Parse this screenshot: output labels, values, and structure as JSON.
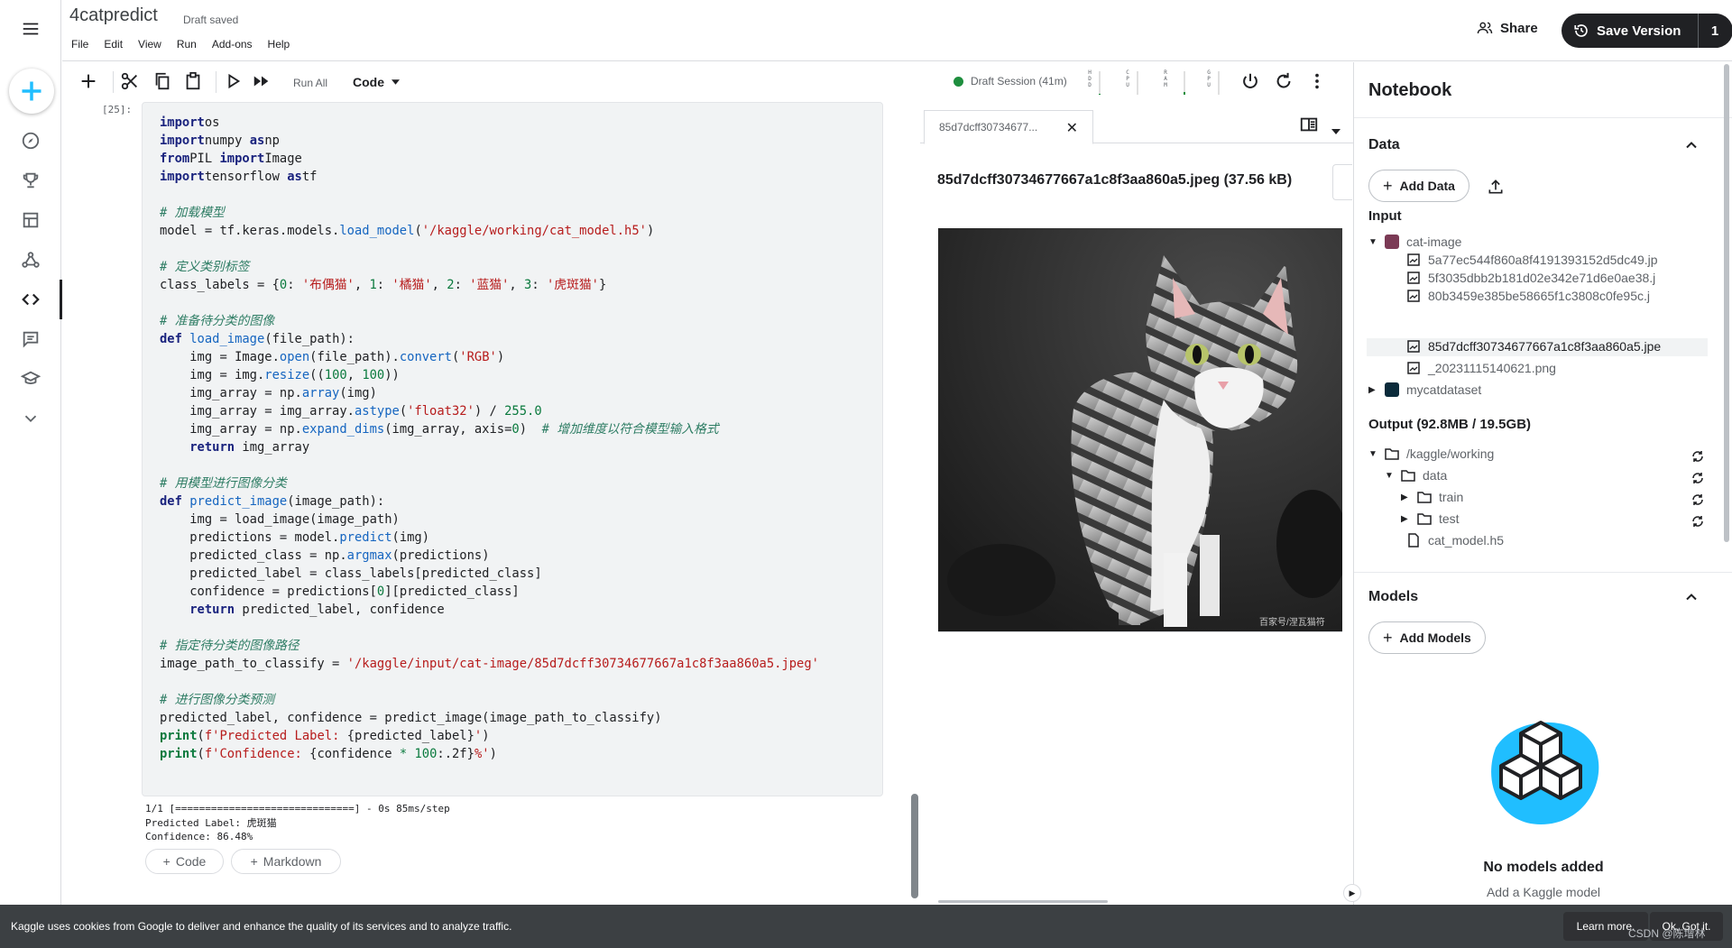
{
  "header": {
    "title": "4catpredict",
    "status": "Draft saved",
    "menu": [
      "File",
      "Edit",
      "View",
      "Run",
      "Add-ons",
      "Help"
    ],
    "share_label": "Share",
    "save_label": "Save Version",
    "save_count": "1"
  },
  "toolbar": {
    "run_all_label": "Run All",
    "cell_type": "Code",
    "session_label": "Draft Session (41m)",
    "meters": [
      {
        "label": "H\nD\nD",
        "level": 0.05
      },
      {
        "label": "C\nP\nU",
        "level": 0.0
      },
      {
        "label": "R\nA\nM",
        "level": 0.1
      },
      {
        "label": "G\nP\nU",
        "level": 0.0
      }
    ]
  },
  "cell": {
    "exec_count": "[25]:",
    "code_lines": [
      [
        [
          "kw",
          "import"
        ],
        [
          "",
          "os"
        ]
      ],
      [
        [
          "kw",
          "import"
        ],
        [
          "",
          "numpy "
        ],
        [
          "kw",
          "as"
        ],
        [
          "",
          "np"
        ]
      ],
      [
        [
          "kw",
          "from"
        ],
        [
          "",
          "PIL "
        ],
        [
          "kw",
          "import"
        ],
        [
          "",
          "Image"
        ]
      ],
      [
        [
          "kw",
          "import"
        ],
        [
          "",
          "tensorflow "
        ],
        [
          "kw",
          "as"
        ],
        [
          "",
          "tf"
        ]
      ],
      [],
      [
        [
          "cm",
          "# 加载模型"
        ]
      ],
      [
        [
          "",
          "model = tf.keras.models."
        ],
        [
          "fn",
          "load_model"
        ],
        [
          "",
          "("
        ],
        [
          "st",
          "'/kaggle/working/cat_model.h5'"
        ],
        [
          "",
          ")"
        ]
      ],
      [],
      [
        [
          "cm",
          "# 定义类别标签"
        ]
      ],
      [
        [
          "",
          "class_labels = {"
        ],
        [
          "nm",
          "0"
        ],
        [
          "",
          ": "
        ],
        [
          "st",
          "'布偶猫'"
        ],
        [
          "",
          ", "
        ],
        [
          "nm",
          "1"
        ],
        [
          "",
          ": "
        ],
        [
          "st",
          "'橘猫'"
        ],
        [
          "",
          ", "
        ],
        [
          "nm",
          "2"
        ],
        [
          "",
          ": "
        ],
        [
          "st",
          "'蓝猫'"
        ],
        [
          "",
          ", "
        ],
        [
          "nm",
          "3"
        ],
        [
          "",
          ": "
        ],
        [
          "st",
          "'虎斑猫'"
        ],
        [
          "",
          "}"
        ]
      ],
      [],
      [
        [
          "cm",
          "# 准备待分类的图像"
        ]
      ],
      [
        [
          "kw",
          "def"
        ],
        [
          "",
          " "
        ],
        [
          "fn",
          "load_image"
        ],
        [
          "",
          "(file_path):"
        ]
      ],
      [
        [
          "",
          "    img = Image."
        ],
        [
          "fn",
          "open"
        ],
        [
          "",
          "(file_path)."
        ],
        [
          "fn",
          "convert"
        ],
        [
          "",
          "("
        ],
        [
          "st",
          "'RGB'"
        ],
        [
          "",
          ")"
        ]
      ],
      [
        [
          "",
          "    img = img."
        ],
        [
          "fn",
          "resize"
        ],
        [
          "",
          "(("
        ],
        [
          "nm",
          "100"
        ],
        [
          "",
          ", "
        ],
        [
          "nm",
          "100"
        ],
        [
          "",
          "))"
        ]
      ],
      [
        [
          "",
          "    img_array = np."
        ],
        [
          "fn",
          "array"
        ],
        [
          "",
          "(img)"
        ]
      ],
      [
        [
          "",
          "    img_array = img_array."
        ],
        [
          "fn",
          "astype"
        ],
        [
          "",
          "("
        ],
        [
          "st",
          "'float32'"
        ],
        [
          "",
          ") / "
        ],
        [
          "nm",
          "255.0"
        ]
      ],
      [
        [
          "",
          "    img_array = np."
        ],
        [
          "fn",
          "expand_dims"
        ],
        [
          "",
          "(img_array, axis="
        ],
        [
          "nm",
          "0"
        ],
        [
          "",
          ")  "
        ],
        [
          "cm",
          "# 增加维度以符合模型输入格式"
        ]
      ],
      [
        [
          "",
          "    "
        ],
        [
          "kw",
          "return"
        ],
        [
          "",
          " img_array"
        ]
      ],
      [],
      [
        [
          "cm",
          "# 用模型进行图像分类"
        ]
      ],
      [
        [
          "kw",
          "def"
        ],
        [
          "",
          " "
        ],
        [
          "fn",
          "predict_image"
        ],
        [
          "",
          "(image_path):"
        ]
      ],
      [
        [
          "",
          "    img = load_image(image_path)"
        ]
      ],
      [
        [
          "",
          "    predictions = model."
        ],
        [
          "fn",
          "predict"
        ],
        [
          "",
          "(img)"
        ]
      ],
      [
        [
          "",
          "    predicted_class = np."
        ],
        [
          "fn",
          "argmax"
        ],
        [
          "",
          "(predictions)"
        ]
      ],
      [
        [
          "",
          "    predicted_label = class_labels[predicted_class]"
        ]
      ],
      [
        [
          "",
          "    confidence = predictions["
        ],
        [
          "nm",
          "0"
        ],
        [
          "",
          "][predicted_class]"
        ]
      ],
      [
        [
          "",
          "    "
        ],
        [
          "kw",
          "return"
        ],
        [
          "",
          " predicted_label, confidence"
        ]
      ],
      [],
      [
        [
          "cm",
          "# 指定待分类的图像路径"
        ]
      ],
      [
        [
          "",
          "image_path_to_classify = "
        ],
        [
          "st",
          "'/kaggle/input/cat-image/85d7dcff30734677667a1c8f3aa860a5.jpeg'"
        ]
      ],
      [],
      [
        [
          "cm",
          "# 进行图像分类预测"
        ]
      ],
      [
        [
          "",
          "predicted_label, confidence = predict_image(image_path_to_classify)"
        ]
      ],
      [
        [
          "kw2",
          "print"
        ],
        [
          "",
          "("
        ],
        [
          "st",
          "f'Predicted Label: "
        ],
        [
          "",
          "{predicted_label}"
        ],
        [
          "st",
          "'"
        ],
        [
          "",
          ")"
        ]
      ],
      [
        [
          "kw2",
          "print"
        ],
        [
          "",
          "("
        ],
        [
          "st",
          "f'Confidence: "
        ],
        [
          "",
          "{confidence "
        ],
        [
          "nm",
          "* 100"
        ],
        [
          "",
          ":.2f}"
        ],
        [
          "st",
          "%'"
        ],
        [
          "",
          ")"
        ]
      ]
    ],
    "output_lines": [
      "1/1 [==============================] - 0s 85ms/step",
      "Predicted Label: 虎斑猫",
      "Confidence: 86.48%"
    ],
    "add_code_label": "Code",
    "add_markdown_label": "Markdown"
  },
  "viewer": {
    "tab_label": "85d7dcff30734677...",
    "file_title": "85d7dcff30734677667a1c8f3aa860a5.jpeg (37.56 kB)",
    "image_watermark": "百家号/涅瓦猫符"
  },
  "panel": {
    "title": "Notebook",
    "data_section": "Data",
    "add_data_label": "Add Data",
    "input_label": "Input",
    "input_tree": {
      "dataset": "cat-image",
      "files": [
        "5a77ec544f860a8f4191393152d5dc49.jp",
        "5f3035dbb2b181d02e342e71d6e0ae38.j",
        "80b3459e385be58665f1c3808c0fe95c.j",
        "85d7dcff30734677667a1c8f3aa860a5.jpe",
        "_20231115140621.png"
      ],
      "dataset2": "mycatdataset"
    },
    "output_label": "Output (92.8MB / 19.5GB)",
    "output_tree": {
      "root": "/kaggle/working",
      "data": "data",
      "train": "train",
      "test": "test",
      "model_file": "cat_model.h5"
    },
    "models_section": "Models",
    "add_models_label": "Add Models",
    "models_empty_title": "No models added",
    "models_empty_sub": "Add a Kaggle model"
  },
  "cookie": {
    "text": "Kaggle uses cookies from Google to deliver and enhance the quality of its services and to analyze traffic.",
    "learn_more": "Learn more.",
    "ok": "Ok, Got it.",
    "watermark": "CSDN @陈增林"
  },
  "colors": {
    "accent": "#20beff",
    "session_green": "#1e8e3e",
    "dark": "#202124"
  }
}
